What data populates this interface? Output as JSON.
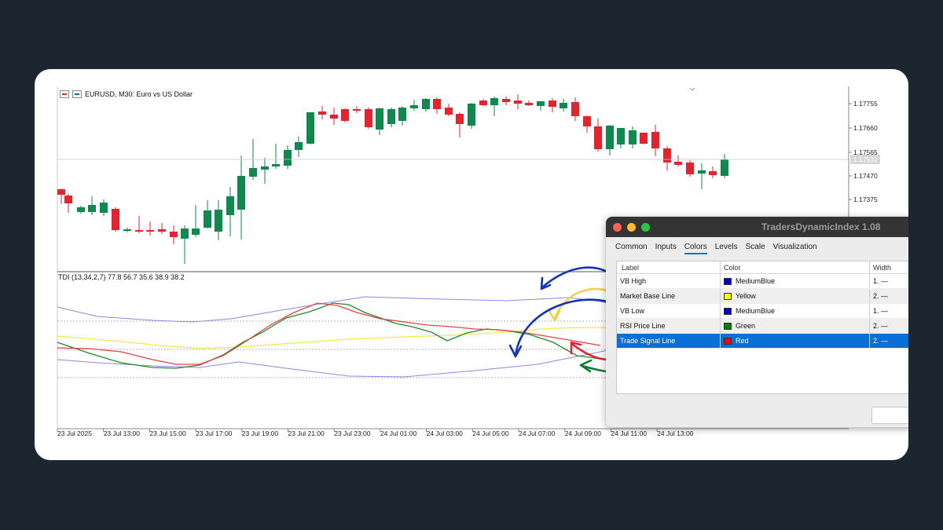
{
  "chart": {
    "symbol_title": "EURUSD, M30:  Euro vs US Dollar",
    "indicator_label": "TDI (13,34,2,7) 77.8 56.7 35.6 38.9 38.2",
    "current_price": "1.17532",
    "price_ticks": [
      "1.17755",
      "1.17660",
      "1.17565",
      "1.17470",
      "1.17375"
    ],
    "time_ticks": [
      "23 Jul 2025",
      "23 Jul 13:00",
      "23 Jul 15:00",
      "23 Jul 17:00",
      "23 Jul 19:00",
      "23 Jul 21:00",
      "23 Jul 23:00",
      "24 Jul 01:00",
      "24 Jul 03:00",
      "24 Jul 05:00",
      "24 Jul 07:00",
      "24 Jul 09:00",
      "24 Jul 11:00",
      "24 Jul 13:00"
    ],
    "colors": {
      "bull": "#0e8a4f",
      "bear": "#e5232f"
    }
  },
  "dialog": {
    "title": "TradersDynamicIndex 1.08",
    "tabs": [
      "Common",
      "Inputs",
      "Colors",
      "Levels",
      "Scale",
      "Visualization"
    ],
    "active_tab": "Colors",
    "columns": [
      "Label",
      "Color",
      "Width"
    ],
    "rows": [
      {
        "label": "VB High",
        "color_name": "MediumBlue",
        "swatch": "#0000cd",
        "width": "1. —"
      },
      {
        "label": "Market Base Line",
        "color_name": "Yellow",
        "swatch": "#ffff00",
        "width": "2. —"
      },
      {
        "label": "VB Low",
        "color_name": "MediumBlue",
        "swatch": "#0000cd",
        "width": "1. —"
      },
      {
        "label": "RSI Price Line",
        "color_name": "Green",
        "swatch": "#008000",
        "width": "2. —"
      },
      {
        "label": "Trade Signal Line",
        "color_name": "Red",
        "swatch": "#ff0000",
        "width": "2. —"
      }
    ],
    "selected_row": "Trade Signal Line",
    "traffic_light_colors": [
      "#fe5f57",
      "#febc2e",
      "#28c840"
    ]
  },
  "annotation_arrow_colors": [
    "#1234b8",
    "#f3cf4a",
    "#1234b8",
    "#0e7a34",
    "#e5232f"
  ]
}
